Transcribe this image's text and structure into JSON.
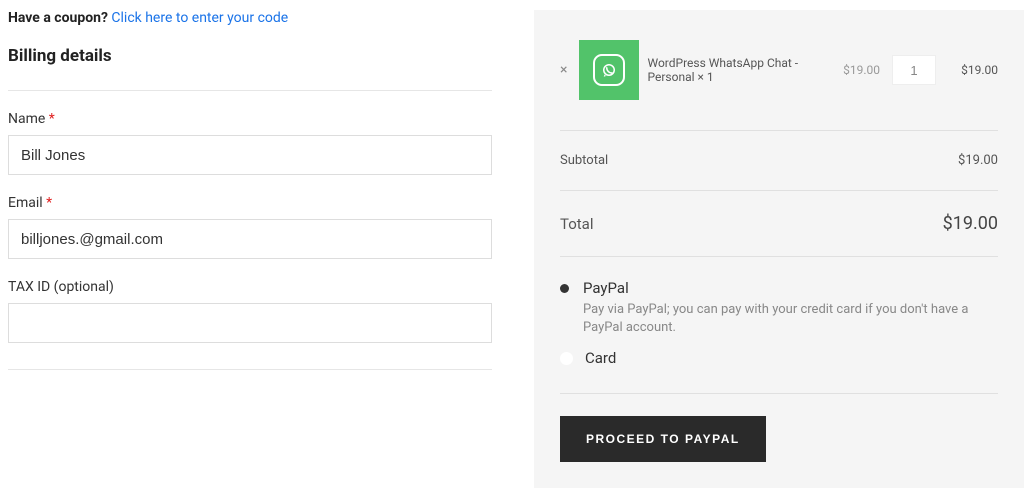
{
  "coupon": {
    "label": "Have a coupon?",
    "link_text": "Click here to enter your code"
  },
  "billing": {
    "title": "Billing details",
    "name_label": "Name",
    "name_value": "Bill Jones",
    "email_label": "Email",
    "email_value": "billjones.@gmail.com",
    "taxid_label": "TAX ID (optional)",
    "taxid_value": "",
    "required_marker": "*"
  },
  "cart": {
    "item": {
      "name": "WordPress WhatsApp Chat - Personal × 1",
      "unit_price": "$19.00",
      "quantity": "1",
      "line_total": "$19.00"
    },
    "subtotal_label": "Subtotal",
    "subtotal_value": "$19.00",
    "total_label": "Total",
    "total_value": "$19.00"
  },
  "payment": {
    "paypal_label": "PayPal",
    "paypal_desc": "Pay via PayPal; you can pay with your credit card if you don't have a PayPal account.",
    "card_label": "Card",
    "proceed_button": "PROCEED TO PAYPAL"
  },
  "icons": {
    "remove": "×"
  }
}
